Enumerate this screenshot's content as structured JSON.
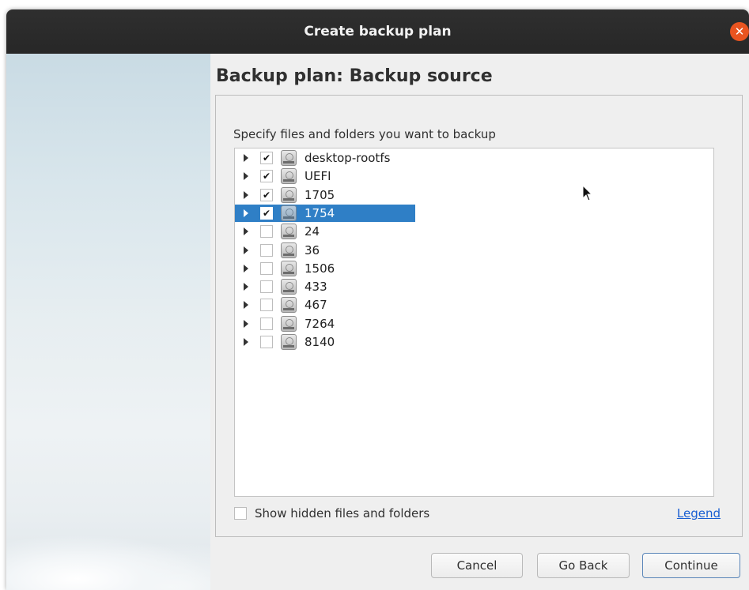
{
  "window": {
    "title": "Create backup plan"
  },
  "page": {
    "heading": "Backup plan: Backup source",
    "instruction": "Specify files and folders you want to backup"
  },
  "tree": {
    "items": [
      {
        "label": "desktop-rootfs",
        "checked": true,
        "selected": false
      },
      {
        "label": "UEFI",
        "checked": true,
        "selected": false
      },
      {
        "label": "1705",
        "checked": true,
        "selected": false
      },
      {
        "label": "1754",
        "checked": true,
        "selected": true
      },
      {
        "label": "24",
        "checked": false,
        "selected": false
      },
      {
        "label": "36",
        "checked": false,
        "selected": false
      },
      {
        "label": "1506",
        "checked": false,
        "selected": false
      },
      {
        "label": "433",
        "checked": false,
        "selected": false
      },
      {
        "label": "467",
        "checked": false,
        "selected": false
      },
      {
        "label": "7264",
        "checked": false,
        "selected": false
      },
      {
        "label": "8140",
        "checked": false,
        "selected": false
      }
    ]
  },
  "options": {
    "show_hidden_label": "Show hidden files and folders",
    "show_hidden_checked": false
  },
  "legend_link": "Legend",
  "buttons": {
    "cancel": "Cancel",
    "go_back": "Go Back",
    "continue": "Continue"
  },
  "icons": {
    "close": "close-icon",
    "expander": "expander-arrow-icon",
    "drive": "drive-icon",
    "pointer": "mouse-pointer-icon"
  },
  "colors": {
    "selection": "#2f7fc6",
    "close_button": "#e95420",
    "link": "#1a5fd2",
    "titlebar": "#2c2c2c"
  }
}
